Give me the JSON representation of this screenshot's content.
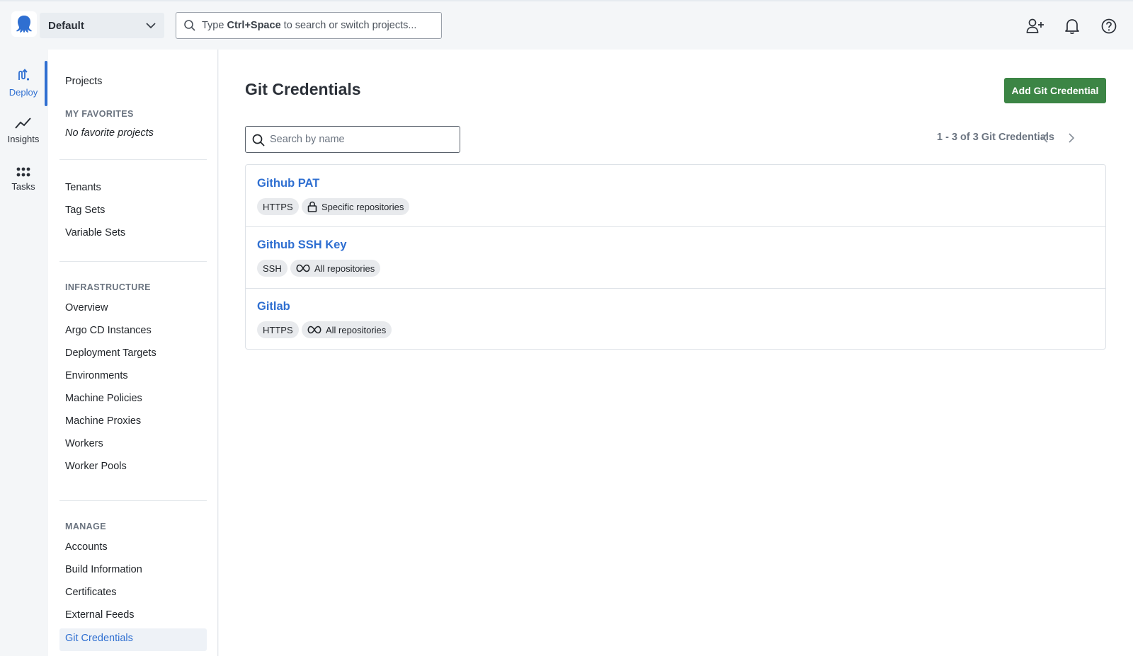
{
  "topbar": {
    "space_name": "Default",
    "search_prefix": "Type ",
    "search_shortcut": "Ctrl+Space",
    "search_suffix": " to search or switch projects..."
  },
  "rail": {
    "items": [
      {
        "label": "Deploy",
        "icon": "deploy-icon"
      },
      {
        "label": "Insights",
        "icon": "chart-line-icon"
      },
      {
        "label": "Tasks",
        "icon": "grid-dots-icon"
      }
    ]
  },
  "sidenav": {
    "projects": "Projects",
    "favorites_heading": "MY FAVORITES",
    "favorites_empty": "No favorite projects",
    "library": [
      "Tenants",
      "Tag Sets",
      "Variable Sets"
    ],
    "infrastructure_heading": "INFRASTRUCTURE",
    "infrastructure": [
      "Overview",
      "Argo CD Instances",
      "Deployment Targets",
      "Environments",
      "Machine Policies",
      "Machine Proxies",
      "Workers",
      "Worker Pools"
    ],
    "manage_heading": "MANAGE",
    "manage": [
      "Accounts",
      "Build Information",
      "Certificates",
      "External Feeds",
      "Git Credentials"
    ]
  },
  "main": {
    "title": "Git Credentials",
    "add_button": "Add Git Credential",
    "search_placeholder": "Search by name",
    "pager_text": "1 - 3 of 3 Git Credentials",
    "credentials": [
      {
        "name": "Github PAT",
        "protocol": "HTTPS",
        "scope": "Specific repositories",
        "scope_icon": "lock-icon"
      },
      {
        "name": "Github SSH Key",
        "protocol": "SSH",
        "scope": "All repositories",
        "scope_icon": "infinity-icon"
      },
      {
        "name": "Gitlab",
        "protocol": "HTTPS",
        "scope": "All repositories",
        "scope_icon": "infinity-icon"
      }
    ]
  },
  "colors": {
    "accent": "#2f6fd1",
    "primary_button": "#3c8545"
  }
}
